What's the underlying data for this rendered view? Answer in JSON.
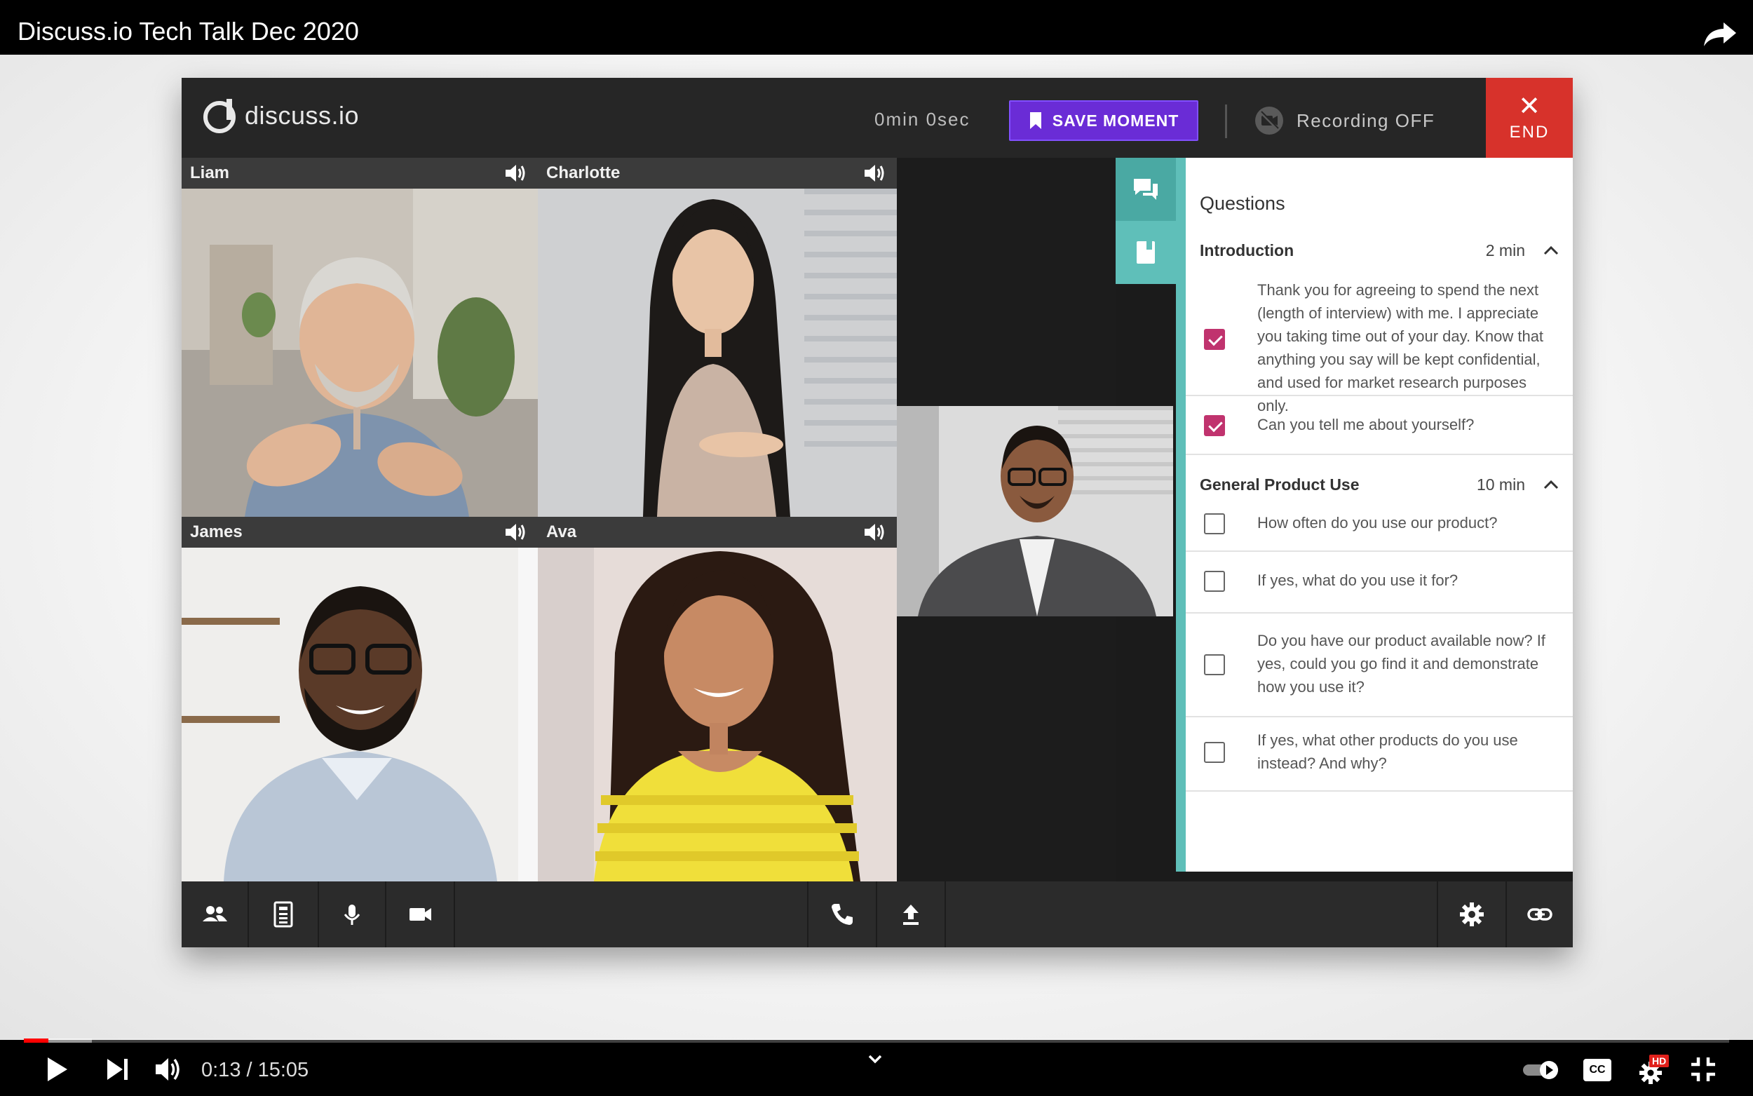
{
  "video": {
    "title": "Discuss.io Tech Talk Dec 2020",
    "time_current": "0:13",
    "time_total": "15:05",
    "time_display": "0:13 / 15:05",
    "progress_fraction": 0.0144,
    "buffered_fraction": 0.04,
    "progress_color": "#ff0000"
  },
  "app": {
    "logo_text": "discuss.io",
    "timer": "0min 0sec",
    "save_moment_label": "SAVE MOMENT",
    "recording_label": "Recording OFF",
    "end_label": "END",
    "accent_purple": "#6a2cd6",
    "end_red": "#d7322b",
    "teal": "#5fbfb9",
    "check_color": "#c0336e"
  },
  "participants": [
    {
      "name": "Liam"
    },
    {
      "name": "Charlotte"
    },
    {
      "name": "James"
    },
    {
      "name": "Ava"
    }
  ],
  "questions": {
    "title": "Questions",
    "sections": [
      {
        "name": "Introduction",
        "duration": "2 min",
        "items": [
          {
            "text": "Thank you for agreeing to spend the next (length of interview) with me. I appreciate you taking time out of your day. Know that anything you say will be kept confidential, and used for market research purposes only.",
            "checked": true
          },
          {
            "text": "Can you tell me about yourself?",
            "checked": true
          }
        ]
      },
      {
        "name": "General Product Use",
        "duration": "10 min",
        "items": [
          {
            "text": "How often do you use our product?",
            "checked": false
          },
          {
            "text": "If yes, what do you use it for?",
            "checked": false
          },
          {
            "text": "Do you have our product available now? If yes, could you go find it and demonstrate how you use it?",
            "checked": false
          },
          {
            "text": "If yes, what other products do you use instead? And why?",
            "checked": false
          }
        ]
      }
    ]
  },
  "toolbar_icons": [
    "participants-icon",
    "notes-icon",
    "microphone-icon",
    "camera-icon",
    "phone-icon",
    "upload-icon",
    "settings-icon",
    "link-icon"
  ],
  "player_icons": [
    "play-icon",
    "next-icon",
    "volume-icon",
    "chevron-down-icon",
    "autoplay-toggle-icon",
    "captions-icon",
    "settings-hd-icon",
    "exit-fullscreen-icon",
    "share-icon"
  ],
  "player_badges": {
    "hd": "HD",
    "cc": "CC"
  }
}
